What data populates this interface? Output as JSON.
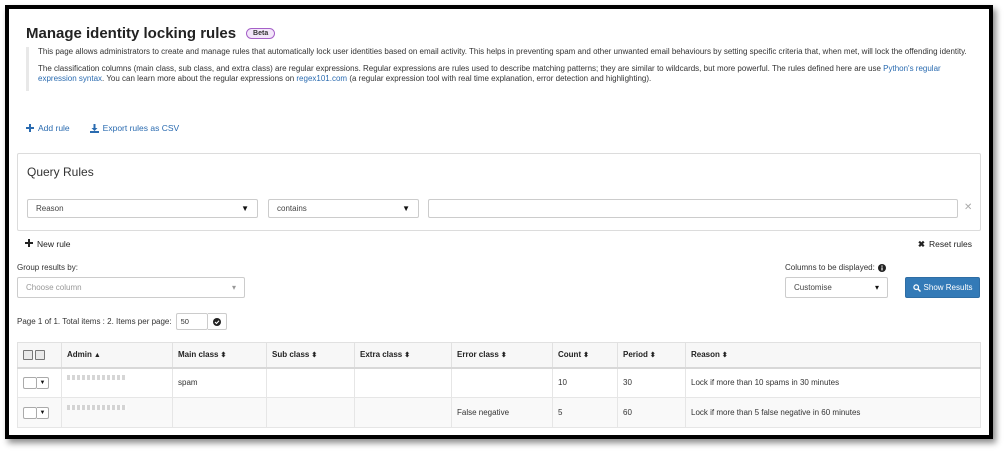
{
  "page": {
    "title": "Manage identity locking rules",
    "badge": "Beta",
    "description_1": "This page allows administrators to create and manage rules that automatically lock user identities based on email activity. This helps in preventing spam and other unwanted email behaviours by setting specific criteria that, when met, will lock the offending identity.",
    "description_2_pre": "The classification columns (main class, sub class, and extra class) are regular expressions. Regular expressions are rules used to describe matching patterns; they are similar to wildcards, but more powerful. The rules defined here are use ",
    "description_2_link1": "Python's regular expression syntax",
    "description_2_mid": ". You can learn more about the regular expressions on ",
    "description_2_link2": "regex101.com",
    "description_2_post": " (a regular expression tool with real time explanation, error detection and highlighting)."
  },
  "actions": {
    "add_rule": "Add rule",
    "export_csv": "Export rules as CSV"
  },
  "query": {
    "title": "Query Rules",
    "field_value": "Reason",
    "operator_value": "contains",
    "search_value": "",
    "new_rule": "New rule",
    "reset_rules": "Reset rules"
  },
  "controls": {
    "group_label": "Group results by:",
    "group_placeholder": "Choose column",
    "columns_label": "Columns to be displayed:",
    "columns_value": "Customise",
    "show_results": "Show Results",
    "pager_text": "Page 1 of 1. Total items : 2. Items per page:",
    "per_page": "50"
  },
  "table": {
    "headers": {
      "admin": "Admin",
      "main_class": "Main class",
      "sub_class": "Sub class",
      "extra_class": "Extra class",
      "error_class": "Error class",
      "count": "Count",
      "period": "Period",
      "reason": "Reason"
    },
    "rows": [
      {
        "main_class": "spam",
        "sub_class": "",
        "extra_class": "",
        "error_class": "",
        "count": "10",
        "period": "30",
        "reason": "Lock if more than 10 spams in 30 minutes"
      },
      {
        "main_class": "",
        "sub_class": "",
        "extra_class": "",
        "error_class": "False negative",
        "count": "5",
        "period": "60",
        "reason": "Lock if more than 5 false negative in 60 minutes"
      }
    ]
  },
  "colors": {
    "link": "#2a6bb0",
    "primary": "#337ab7",
    "beta_border": "#a560c8"
  }
}
